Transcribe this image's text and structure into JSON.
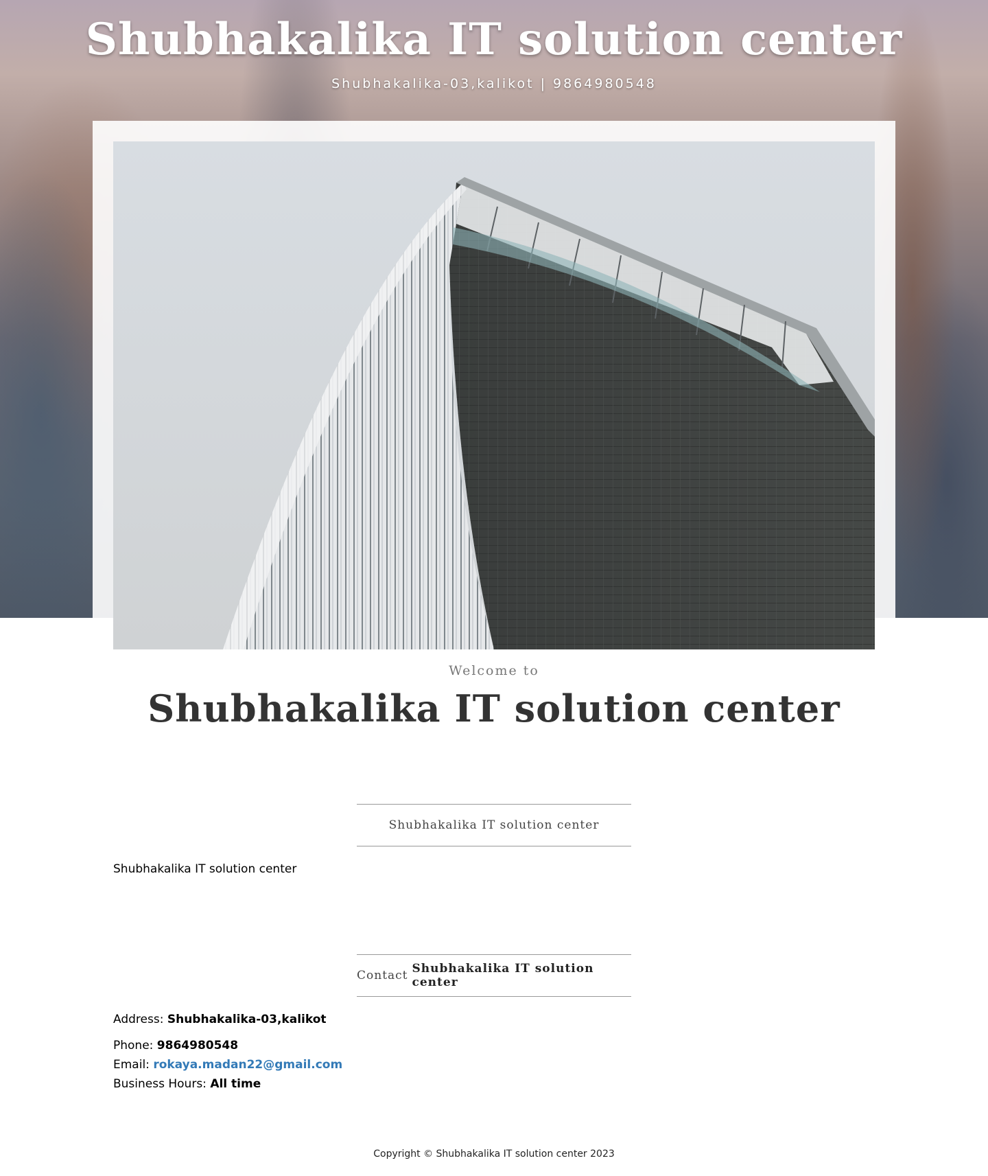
{
  "header": {
    "title": "Shubhakalika IT solution center",
    "subtitle": "Shubhakalika-03,kalikot | 9864980548"
  },
  "intro": {
    "welcome": "Welcome to",
    "title": "Shubhakalika IT solution center"
  },
  "about": {
    "heading": "Shubhakalika IT solution center",
    "text": "Shubhakalika IT solution center"
  },
  "contact": {
    "heading_prefix": "Contact",
    "heading_name": "Shubhakalika IT solution center",
    "address_label": "Address:",
    "address_value": "Shubhakalika-03,kalikot",
    "phone_label": "Phone:",
    "phone_value": "9864980548",
    "email_label": "Email:",
    "email_value": "rokaya.madan22@gmail.com",
    "hours_label": "Business Hours:",
    "hours_value": "All time"
  },
  "footer": {
    "copyright": "Copyright © Shubhakalika IT solution center 2023"
  },
  "colors": {
    "link": "#337ab7",
    "heading": "#333333"
  }
}
